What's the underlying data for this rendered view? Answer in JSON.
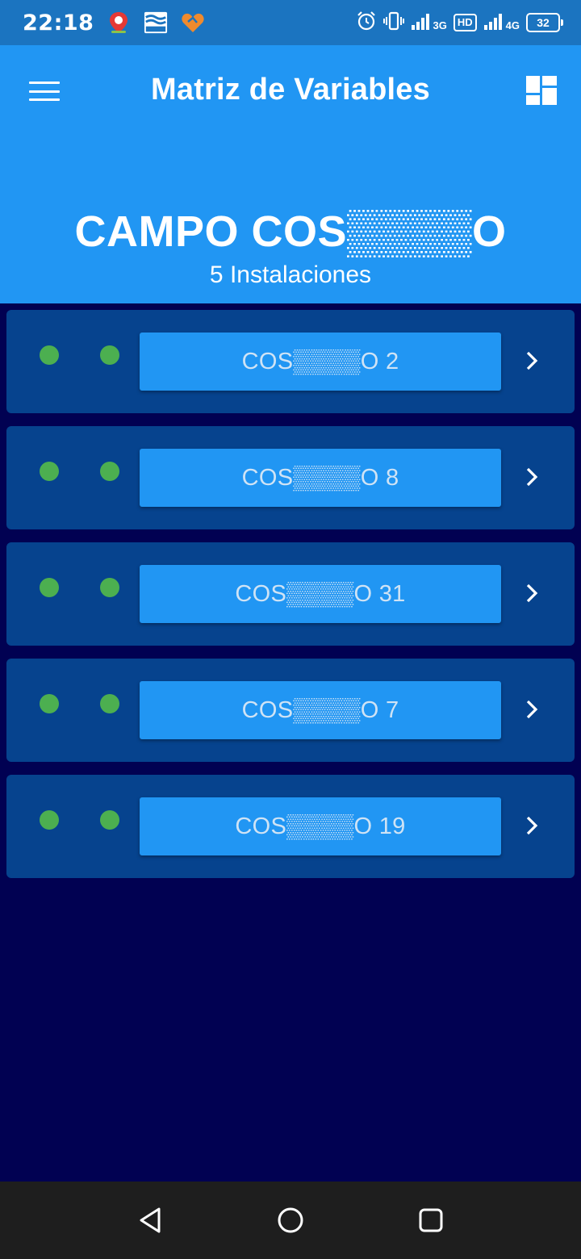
{
  "status_bar": {
    "time": "22:18",
    "notification_icons": [
      "location-pin-icon",
      "diavaz-app-icon",
      "heart-app-icon"
    ],
    "net_label_1": "3G",
    "hd_label": "HD",
    "net_label_2": "4G",
    "battery_level": "32",
    "right_icons": [
      "alarm-icon",
      "vibrate-icon",
      "signal-icon",
      "signal-icon",
      "battery-icon"
    ]
  },
  "app_bar": {
    "title": "Matriz de Variables",
    "menu_icon": "hamburger-menu-icon",
    "action_icon": "dashboard-icon"
  },
  "header": {
    "campo_title": "CAMPO COS▒▒▒▒O",
    "subtitle": "5 Instalaciones"
  },
  "installations": [
    {
      "label": "COS▒▒▒▒O 2",
      "status_1": "green",
      "status_2": "green"
    },
    {
      "label": "COS▒▒▒▒O 8",
      "status_1": "green",
      "status_2": "green"
    },
    {
      "label": "COS▒▒▒▒O 31",
      "status_1": "green",
      "status_2": "green"
    },
    {
      "label": "COS▒▒▒▒O 7",
      "status_1": "green",
      "status_2": "green"
    },
    {
      "label": "COS▒▒▒▒O 19",
      "status_1": "green",
      "status_2": "green"
    }
  ],
  "nav_bar": {
    "buttons": [
      "back-icon",
      "home-icon",
      "recents-icon"
    ]
  },
  "colors": {
    "status_bar": "#1b74c0",
    "app_bar": "#2196f3",
    "background": "#010152",
    "card": "#06438e",
    "button": "#2196f3",
    "status_ok": "#4caf50",
    "nav_bar": "#1e1e1e"
  }
}
